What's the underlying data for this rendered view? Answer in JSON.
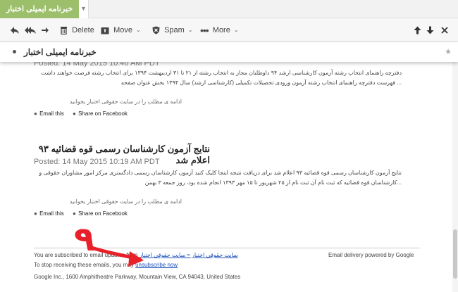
{
  "tab": {
    "title": "خبرنامه ایمیلی اختبار"
  },
  "toolbar": {
    "delete_label": "Delete",
    "move_label": "Move",
    "spam_label": "Spam",
    "more_label": "More"
  },
  "subject": {
    "title": "خبرنامه ایمیلی اختبار"
  },
  "post1": {
    "posted": "Posted: 14 May 2015 10:40 AM PDT",
    "line1": "دفترچه راهنمای انتخاب رشته آزمون کارشناسی ارشد ۹۴ داوطلبان مجاز به انتخاب رشته از ۲۱ تا ۳۱ اردیبهشت ۱۳۹۴ برای انتخاب رشته فرصت خواهند داشت",
    "line2": "... فهرست دفترچه راهنمای انتخاب رشته آزمون ورودی تحصیلات تکمیلی (کارشناسی ارشد) سال ۱۳۹۴ بخش عنوان صفحه",
    "more": "ادامه ی مطلب را در سایت حقوقی اختبار بخوانید",
    "email_this": "Email this",
    "share_fb": "Share on Facebook"
  },
  "post2": {
    "title": "نتایج آزمون کارشناسان رسمی قوه قضائیه ۹۳ اعلام شد",
    "posted": "Posted: 14 May 2015 10:19 AM PDT",
    "line1": "نتایج آزمون کارشناسان رسمی قوه قضائیه ۹۳ اعلام شد برای دریافت نتیجه اینجا کلیک کنید آزمون کارشناسان رسمی دادگستری مرکز امور مشاوران حقوقی و",
    "line2": "...کارشناسان قوه قضائیه که ثبت نام آن ثبت نام از ۲۵ شهریور تا ۱۵ مهر ۱۳۹۳ انجام شده بود، روز جمعه ۳ بهمن",
    "more": "ادامه ی مطلب را در سایت حقوقی اختبار بخوانید",
    "email_this": "Email this",
    "share_fb": "Share on Facebook"
  },
  "footer": {
    "subscribed_prefix": "You are subscribed to email updates from",
    "subscribed_link": "سایت حقوقی اختبار ≈ سایت حقوقی اختبار",
    "delivery": "Email delivery powered by Google",
    "stop_prefix": "To stop receiving these emails, you may",
    "unsubscribe": "unsubscribe now",
    "address": "Google Inc., 1600 Amphitheatre Parkway, Mountain View, CA 94043, United States"
  },
  "annotation": {
    "number": "۹",
    "color": "#e8202a"
  }
}
